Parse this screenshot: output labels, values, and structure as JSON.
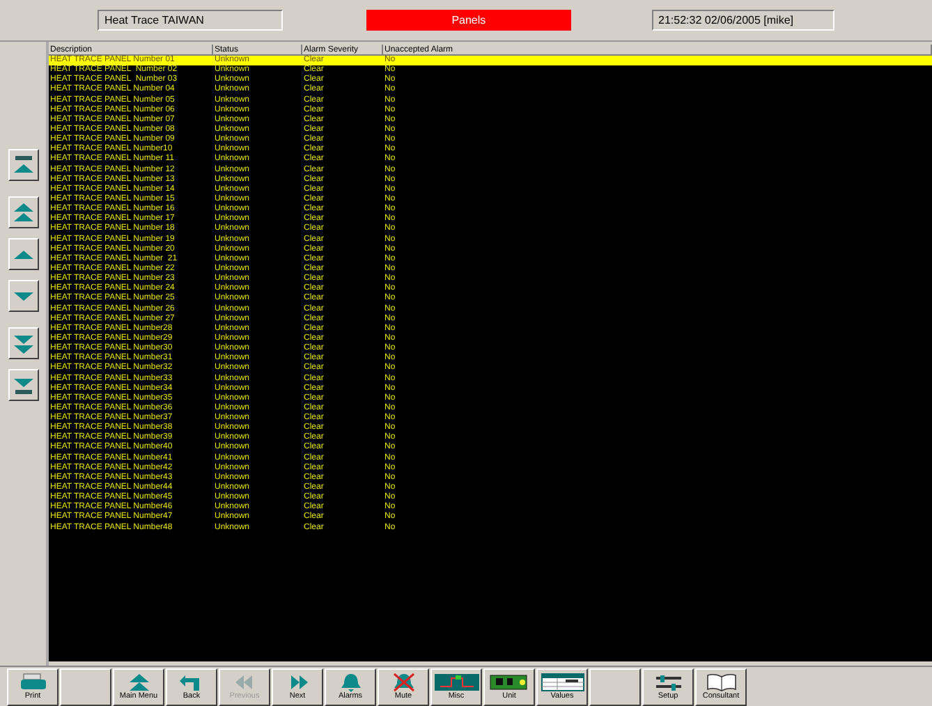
{
  "header": {
    "site": "Heat Trace TAIWAN",
    "page_title": "Panels",
    "clock": "21:52:32 02/06/2005 [mike]"
  },
  "table": {
    "columns": [
      "Description",
      "Status",
      "Alarm Severity",
      "Unaccepted Alarm"
    ],
    "rows": [
      {
        "cells": [
          "HEAT TRACE PANEL Number 01",
          "Unknown",
          "Clear",
          "No"
        ],
        "selected": true
      },
      {
        "cells": [
          "HEAT TRACE PANEL  Number 02",
          "Unknown",
          "Clear",
          "No"
        ],
        "selected": false
      },
      {
        "cells": [
          "HEAT TRACE PANEL  Number 03",
          "Unknown",
          "Clear",
          "No"
        ],
        "selected": false
      },
      {
        "cells": [
          "HEAT TRACE PANEL Number 04",
          "Unknown",
          "Clear",
          "No"
        ],
        "selected": false
      },
      {
        "cells": [
          "HEAT TRACE PANEL Number 05",
          "Unknown",
          "Clear",
          "No"
        ],
        "selected": false
      },
      {
        "cells": [
          "HEAT TRACE PANEL Number 06",
          "Unknown",
          "Clear",
          "No"
        ],
        "selected": false
      },
      {
        "cells": [
          "HEAT TRACE PANEL Number 07",
          "Unknown",
          "Clear",
          "No"
        ],
        "selected": false
      },
      {
        "cells": [
          "HEAT TRACE PANEL Number 08",
          "Unknown",
          "Clear",
          "No"
        ],
        "selected": false
      },
      {
        "cells": [
          "HEAT TRACE PANEL Number 09",
          "Unknown",
          "Clear",
          "No"
        ],
        "selected": false
      },
      {
        "cells": [
          "HEAT TRACE PANEL Number10",
          "Unknown",
          "Clear",
          "No"
        ],
        "selected": false
      },
      {
        "cells": [
          "HEAT TRACE PANEL Number 11",
          "Unknown",
          "Clear",
          "No"
        ],
        "selected": false
      },
      {
        "cells": [
          "HEAT TRACE PANEL Number 12",
          "Unknown",
          "Clear",
          "No"
        ],
        "selected": false
      },
      {
        "cells": [
          "HEAT TRACE PANEL Number 13",
          "Unknown",
          "Clear",
          "No"
        ],
        "selected": false
      },
      {
        "cells": [
          "HEAT TRACE PANEL Number 14",
          "Unknown",
          "Clear",
          "No"
        ],
        "selected": false
      },
      {
        "cells": [
          "HEAT TRACE PANEL Number 15",
          "Unknown",
          "Clear",
          "No"
        ],
        "selected": false
      },
      {
        "cells": [
          "HEAT TRACE PANEL Number 16",
          "Unknown",
          "Clear",
          "No"
        ],
        "selected": false
      },
      {
        "cells": [
          "HEAT TRACE PANEL Number 17",
          "Unknown",
          "Clear",
          "No"
        ],
        "selected": false
      },
      {
        "cells": [
          "HEAT TRACE PANEL Number 18",
          "Unknown",
          "Clear",
          "No"
        ],
        "selected": false
      },
      {
        "cells": [
          "HEAT TRACE PANEL Number 19",
          "Unknown",
          "Clear",
          "No"
        ],
        "selected": false
      },
      {
        "cells": [
          "HEAT TRACE PANEL Number 20",
          "Unknown",
          "Clear",
          "No"
        ],
        "selected": false
      },
      {
        "cells": [
          "HEAT TRACE PANEL Number  21",
          "Unknown",
          "Clear",
          "No"
        ],
        "selected": false
      },
      {
        "cells": [
          "HEAT TRACE PANEL Number 22",
          "Unknown",
          "Clear",
          "No"
        ],
        "selected": false
      },
      {
        "cells": [
          "HEAT TRACE PANEL Number 23",
          "Unknown",
          "Clear",
          "No"
        ],
        "selected": false
      },
      {
        "cells": [
          "HEAT TRACE PANEL Number 24",
          "Unknown",
          "Clear",
          "No"
        ],
        "selected": false
      },
      {
        "cells": [
          "HEAT TRACE PANEL Number 25",
          "Unknown",
          "Clear",
          "No"
        ],
        "selected": false
      },
      {
        "cells": [
          "HEAT TRACE PANEL Number 26",
          "Unknown",
          "Clear",
          "No"
        ],
        "selected": false
      },
      {
        "cells": [
          "HEAT TRACE PANEL Number 27",
          "Unknown",
          "Clear",
          "No"
        ],
        "selected": false
      },
      {
        "cells": [
          "HEAT TRACE PANEL Number28",
          "Unknown",
          "Clear",
          "No"
        ],
        "selected": false
      },
      {
        "cells": [
          "HEAT TRACE PANEL Number29",
          "Unknown",
          "Clear",
          "No"
        ],
        "selected": false
      },
      {
        "cells": [
          "HEAT TRACE PANEL Number30",
          "Unknown",
          "Clear",
          "No"
        ],
        "selected": false
      },
      {
        "cells": [
          "HEAT TRACE PANEL Number31",
          "Unknown",
          "Clear",
          "No"
        ],
        "selected": false
      },
      {
        "cells": [
          "HEAT TRACE PANEL Number32",
          "Unknown",
          "Clear",
          "No"
        ],
        "selected": false
      },
      {
        "cells": [
          "HEAT TRACE PANEL Number33",
          "Unknown",
          "Clear",
          "No"
        ],
        "selected": false
      },
      {
        "cells": [
          "HEAT TRACE PANEL Number34",
          "Unknown",
          "Clear",
          "No"
        ],
        "selected": false
      },
      {
        "cells": [
          "HEAT TRACE PANEL Number35",
          "Unknown",
          "Clear",
          "No"
        ],
        "selected": false
      },
      {
        "cells": [
          "HEAT TRACE PANEL Number36",
          "Unknown",
          "Clear",
          "No"
        ],
        "selected": false
      },
      {
        "cells": [
          "HEAT TRACE PANEL Number37",
          "Unknown",
          "Clear",
          "No"
        ],
        "selected": false
      },
      {
        "cells": [
          "HEAT TRACE PANEL Number38",
          "Unknown",
          "Clear",
          "No"
        ],
        "selected": false
      },
      {
        "cells": [
          "HEAT TRACE PANEL Number39",
          "Unknown",
          "Clear",
          "No"
        ],
        "selected": false
      },
      {
        "cells": [
          "HEAT TRACE PANEL Number40",
          "Unknown",
          "Clear",
          "No"
        ],
        "selected": false
      },
      {
        "cells": [
          "HEAT TRACE PANEL Number41",
          "Unknown",
          "Clear",
          "No"
        ],
        "selected": false
      },
      {
        "cells": [
          "HEAT TRACE PANEL Number42",
          "Unknown",
          "Clear",
          "No"
        ],
        "selected": false
      },
      {
        "cells": [
          "HEAT TRACE PANEL Number43",
          "Unknown",
          "Clear",
          "No"
        ],
        "selected": false
      },
      {
        "cells": [
          "HEAT TRACE PANEL Number44",
          "Unknown",
          "Clear",
          "No"
        ],
        "selected": false
      },
      {
        "cells": [
          "HEAT TRACE PANEL Number45",
          "Unknown",
          "Clear",
          "No"
        ],
        "selected": false
      },
      {
        "cells": [
          "HEAT TRACE PANEL Number46",
          "Unknown",
          "Clear",
          "No"
        ],
        "selected": false
      },
      {
        "cells": [
          "HEAT TRACE PANEL Number47",
          "Unknown",
          "Clear",
          "No"
        ],
        "selected": false
      },
      {
        "cells": [
          "HEAT TRACE PANEL Number48",
          "Unknown",
          "Clear",
          "No"
        ],
        "selected": false
      }
    ]
  },
  "scroll_buttons": [
    {
      "kind": "top"
    },
    {
      "kind": "page-up"
    },
    {
      "kind": "up"
    },
    {
      "kind": "down"
    },
    {
      "kind": "page-down"
    },
    {
      "kind": "bottom"
    }
  ],
  "toolbar": [
    {
      "kind": "print",
      "label": "Print",
      "disabled": false
    },
    {
      "kind": "blank"
    },
    {
      "kind": "main-menu",
      "label": "Main Menu",
      "disabled": false
    },
    {
      "kind": "back",
      "label": "Back",
      "disabled": false
    },
    {
      "kind": "previous",
      "label": "Previous",
      "disabled": true
    },
    {
      "kind": "next",
      "label": "Next",
      "disabled": false
    },
    {
      "kind": "alarms",
      "label": "Alarms",
      "disabled": false
    },
    {
      "kind": "mute",
      "label": "Mute",
      "disabled": false
    },
    {
      "kind": "misc",
      "label": "Misc",
      "disabled": false
    },
    {
      "kind": "unit",
      "label": "Unit",
      "disabled": false
    },
    {
      "kind": "values",
      "label": "Values",
      "disabled": false
    },
    {
      "kind": "blank"
    },
    {
      "kind": "setup",
      "label": "Setup",
      "disabled": false
    },
    {
      "kind": "consultant",
      "label": "Consultant",
      "disabled": false
    }
  ]
}
